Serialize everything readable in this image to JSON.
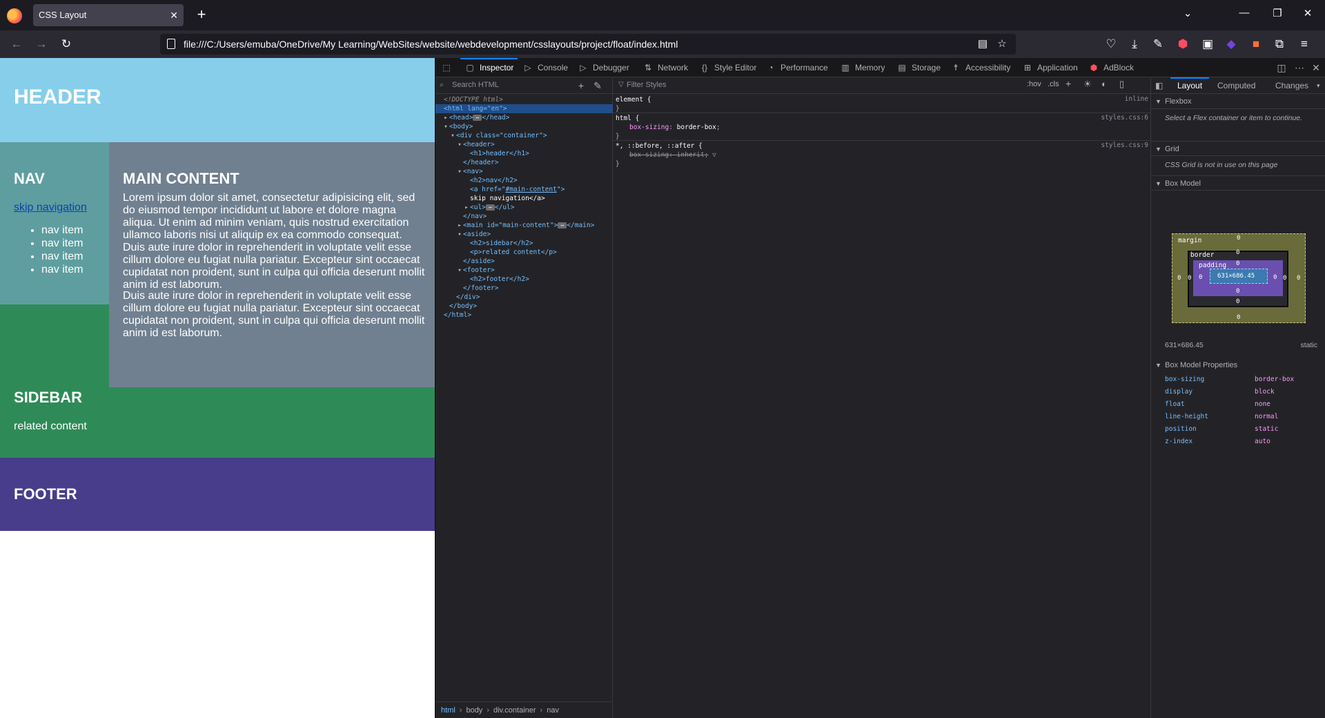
{
  "browser": {
    "tab_title": "CSS Layout",
    "tab_close": "✕",
    "new_tab": "+",
    "url": "file:///C:/Users/emuba/OneDrive/My Learning/WebSites/website/webdevelopment/csslayouts/project/float/index.html",
    "icons": [
      "firefox-logo",
      "back-icon",
      "forward-icon",
      "reload-icon",
      "reader-view-icon",
      "bookmark-star-icon",
      "pocket-icon",
      "downloads-icon",
      "tools-icon",
      "extension-icons",
      "menu-icon"
    ]
  },
  "page": {
    "header": "HEADER",
    "nav_title": "NAV",
    "skip_link": "skip navigation",
    "nav_items": [
      "nav item",
      "nav item",
      "nav item",
      "nav item"
    ],
    "main_title": "MAIN CONTENT",
    "main_p1": "Lorem ipsum dolor sit amet, consectetur adipisicing elit, sed do eiusmod tempor incididunt ut labore et dolore magna aliqua. Ut enim ad minim veniam, quis nostrud exercitation ullamco laboris nisi ut aliquip ex ea commodo consequat. Duis aute irure dolor in reprehenderit in voluptate velit esse cillum dolore eu fugiat nulla pariatur. Excepteur sint occaecat cupidatat non proident, sunt in culpa qui officia deserunt mollit anim id est laborum.",
    "main_p2": "Duis aute irure dolor in reprehenderit in voluptate velit esse cillum dolore eu fugiat nulla pariatur. Excepteur sint occaecat cupidatat non proident, sunt in culpa qui officia deserunt mollit anim id est laborum.",
    "sidebar_title": "SIDEBAR",
    "sidebar_text": "related content",
    "footer_title": "FOOTER",
    "colors": {
      "header": "#87ceeb",
      "nav": "#5f9ea0",
      "main": "#708090",
      "aside": "#2e8b57",
      "footer": "#483d8b"
    }
  },
  "devtools": {
    "tabs": [
      "Inspector",
      "Console",
      "Debugger",
      "Network",
      "Style Editor",
      "Performance",
      "Memory",
      "Storage",
      "Accessibility",
      "Application",
      "AdBlock"
    ],
    "selected_tab": "Inspector",
    "search_placeholder": "Search HTML",
    "filter_styles_placeholder": "Filter Styles",
    "hov": ":hov",
    "cls": ".cls",
    "markup": {
      "doctype": "<!DOCTYPE html>",
      "html_open": "<html lang=\"en\">",
      "head": "<head>",
      "head_close": "</head>",
      "body_open": "<body>",
      "div_open": "<div class=\"container\">",
      "header_open": "<header>",
      "h1": "<h1>header</h1>",
      "header_close": "</header>",
      "nav_open": "<nav>",
      "h2_nav": "<h2>nav</h2>",
      "a_open_pre": "<a href=\"",
      "a_href": "#main-content",
      "a_open_post": "\">",
      "a_text": "skip navigation</a>",
      "ul": "<ul>",
      "ul_close": "</ul>",
      "nav_close": "</nav>",
      "main_open": "<main id=\"main-content\">",
      "main_close": "</main>",
      "aside_open": "<aside>",
      "h2_aside": "<h2>sidebar</h2>",
      "p_related": "<p>related content</p>",
      "aside_close": "</aside>",
      "footer_open": "<footer>",
      "h2_footer": "<h2>footer</h2>",
      "footer_close": "</footer>",
      "div_close": "</div>",
      "body_close": "</body>",
      "html_close": "</html>"
    },
    "breadcrumbs": [
      "html",
      "body",
      "div.container",
      "nav"
    ],
    "rules": [
      {
        "selector": "element {",
        "source": "inline",
        "decls": []
      },
      {
        "selector": "html {",
        "source": "styles.css:6",
        "decls": [
          {
            "prop": "box-sizing",
            "val": "border-box"
          }
        ]
      },
      {
        "selector": "*, ::before, ::after {",
        "source": "styles.css:9",
        "decls": [
          {
            "prop": "box-sizing",
            "val": "inherit",
            "overridden": true
          }
        ]
      }
    ],
    "sidebar_tabs": [
      "Layout",
      "Computed",
      "Changes"
    ],
    "selected_sidebar_tab": "Layout",
    "flexbox_title": "Flexbox",
    "flexbox_note": "Select a Flex container or item to continue.",
    "grid_title": "Grid",
    "grid_note": "CSS Grid is not in use on this page",
    "boxmodel_title": "Box Model",
    "boxmodel": {
      "margin_label": "margin",
      "border_label": "border",
      "padding_label": "padding",
      "zero": "0",
      "content": "631×686.45"
    },
    "dimensions": "631×686.45",
    "position": "static",
    "props_title": "Box Model Properties",
    "props": [
      {
        "k": "box-sizing",
        "v": "border-box"
      },
      {
        "k": "display",
        "v": "block"
      },
      {
        "k": "float",
        "v": "none"
      },
      {
        "k": "line-height",
        "v": "normal"
      },
      {
        "k": "position",
        "v": "static"
      },
      {
        "k": "z-index",
        "v": "auto"
      }
    ]
  }
}
